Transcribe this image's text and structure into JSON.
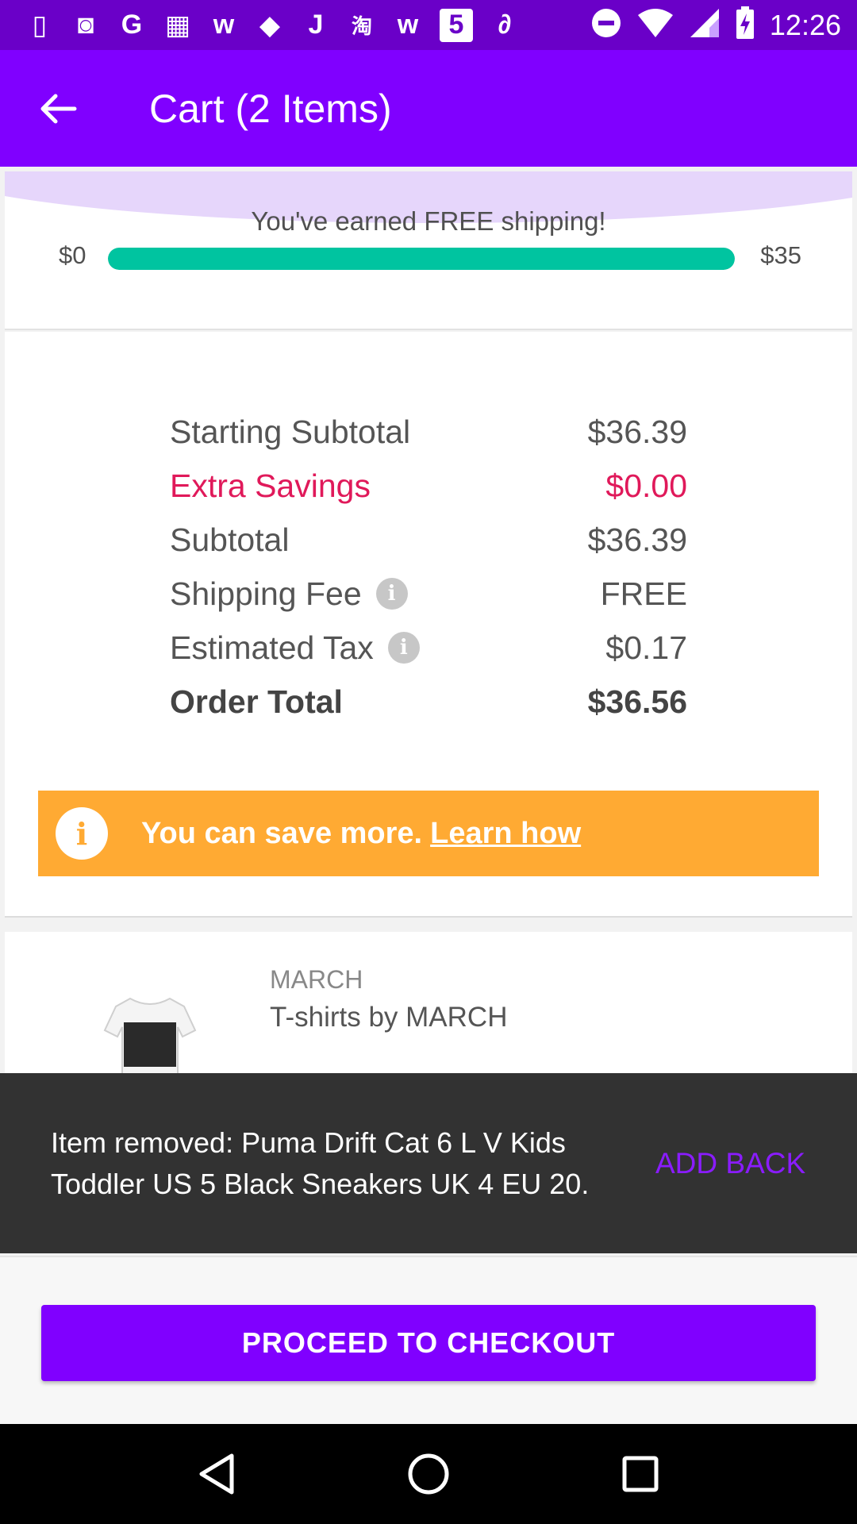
{
  "status_bar": {
    "time": "12:26",
    "icons": [
      "sim-icon",
      "save-icon",
      "google-icon",
      "grid-icon",
      "w-app-icon",
      "shopping-bag-icon",
      "j-app-icon",
      "taobao-icon",
      "w-app-icon",
      "five-app-icon",
      "link-icon",
      "dnd-icon",
      "wifi-icon",
      "signal-icon",
      "battery-charging-icon"
    ],
    "icon_glyphs": [
      "▯",
      "◙",
      "G",
      "▦",
      "w",
      "◆",
      "J",
      "淘",
      "w",
      "5",
      "∂"
    ]
  },
  "app_bar": {
    "title": "Cart (2 Items)"
  },
  "shipping": {
    "message": "You've earned FREE shipping!",
    "min_label": "$0",
    "max_label": "$35",
    "progress_fraction": 1.0,
    "bar_color": "#00c4a0"
  },
  "summary": {
    "rows": [
      {
        "label": "Starting Subtotal",
        "value": "$36.39"
      },
      {
        "label": "Extra Savings",
        "value": "$0.00"
      },
      {
        "label": "Subtotal",
        "value": "$36.39"
      },
      {
        "label": "Shipping Fee",
        "value": "FREE"
      },
      {
        "label": "Estimated Tax",
        "value": "$0.17"
      },
      {
        "label": "Order Total",
        "value": "$36.56"
      }
    ],
    "info_glyph": "i",
    "savings_color": "#e0195a"
  },
  "save_banner": {
    "text": "You can save more.",
    "link": "Learn how",
    "icon_glyph": "i",
    "color": "#ffaa33"
  },
  "item": {
    "brand": "MARCH",
    "title": "T-shirts by MARCH"
  },
  "snackbar": {
    "message": "Item removed: Puma Drift Cat 6 L V Kids Toddler US 5 Black Sneakers UK 4 EU 20.",
    "action": "ADD BACK"
  },
  "checkout": {
    "label": "PROCEED TO CHECKOUT",
    "color": "#8000ff"
  }
}
